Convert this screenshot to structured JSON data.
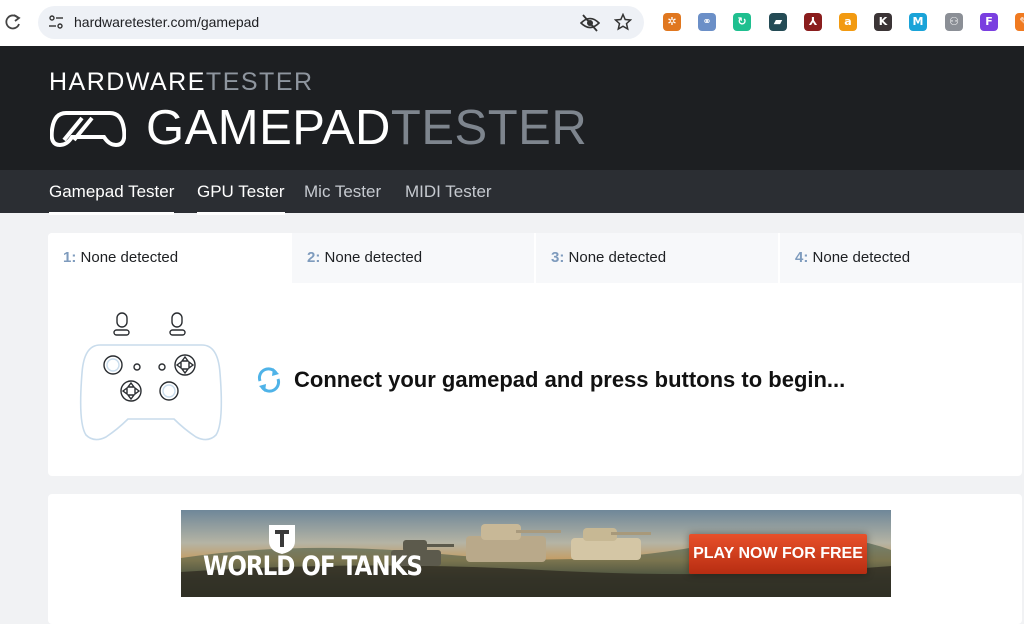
{
  "browser": {
    "url": "hardwaretester.com/gamepad",
    "extensions": [
      {
        "name": "extension-1",
        "glyph": "✲",
        "color": "#e0771f"
      },
      {
        "name": "extension-2",
        "glyph": "⚭",
        "color": "#6b8fc7"
      },
      {
        "name": "extension-3",
        "glyph": "↻",
        "color": "#1fbf8f"
      },
      {
        "name": "extension-4",
        "glyph": "▰",
        "color": "#244b55"
      },
      {
        "name": "extension-5",
        "glyph": "⅄",
        "color": "#8a1d1d"
      },
      {
        "name": "extension-6",
        "glyph": "a",
        "color": "#f29a11"
      },
      {
        "name": "extension-7",
        "glyph": "K",
        "color": "#3b3436"
      },
      {
        "name": "extension-8",
        "glyph": "M",
        "color": "#1aa3d8"
      },
      {
        "name": "extension-9",
        "glyph": "⚇",
        "color": "#8b8f96"
      },
      {
        "name": "extension-10",
        "glyph": "F",
        "color": "#7a3fe0"
      },
      {
        "name": "extension-11",
        "glyph": "✎",
        "color": "#f07a20"
      }
    ]
  },
  "header": {
    "brand_small_a": "HARDWARE",
    "brand_small_b": "TESTER",
    "brand_big_a": "GAMEPAD",
    "brand_big_b": "TESTER"
  },
  "nav": {
    "items": [
      {
        "label": "Gamepad Tester",
        "active": true
      },
      {
        "label": "GPU Tester",
        "active": true
      },
      {
        "label": "Mic Tester",
        "active": false
      },
      {
        "label": "MIDI Tester",
        "active": false
      }
    ]
  },
  "tabs": [
    {
      "num": "1:",
      "label": "None detected"
    },
    {
      "num": "2:",
      "label": "None detected"
    },
    {
      "num": "3:",
      "label": "None detected"
    },
    {
      "num": "4:",
      "label": "None detected"
    }
  ],
  "main": {
    "message": "Connect your gamepad and press buttons to begin..."
  },
  "ad": {
    "logo_text": "WORLD OF TANKS",
    "cta": "PLAY NOW FOR FREE"
  }
}
